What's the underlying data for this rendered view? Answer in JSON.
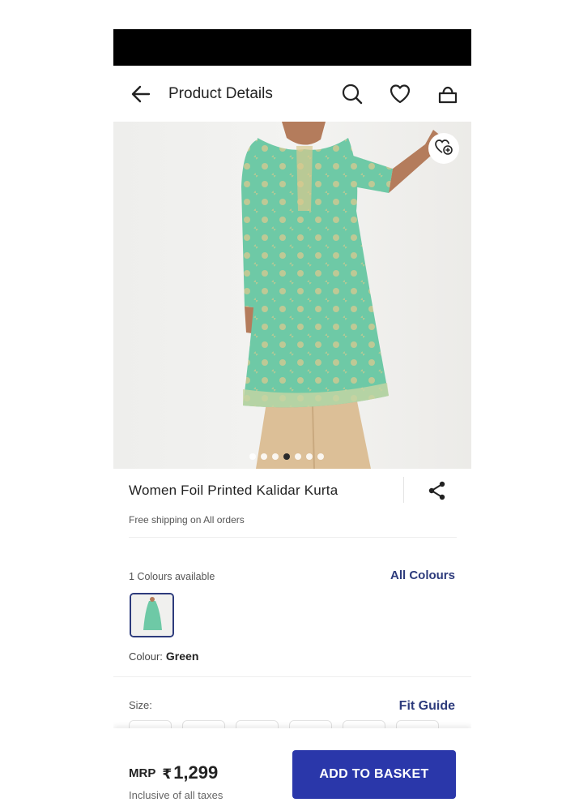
{
  "header": {
    "title": "Product Details",
    "icons": [
      "back-arrow-icon",
      "search-icon",
      "heart-icon",
      "bag-icon"
    ]
  },
  "gallery": {
    "image_count": 7,
    "active_index": 3,
    "wishlist_icon": "heart-plus-icon"
  },
  "product": {
    "name": "Women Foil Printed Kalidar Kurta",
    "shipping_note": "Free shipping on All orders"
  },
  "colours": {
    "count_label": "1 Colours available",
    "all_link": "All Colours",
    "label": "Colour:",
    "selected": "Green"
  },
  "size": {
    "label": "Size:",
    "fit_guide": "Fit Guide"
  },
  "footer": {
    "mrp_label": "MRP",
    "currency": "₹",
    "price": "1,299",
    "tax_note": "Inclusive of all taxes",
    "cta": "ADD TO BASKET"
  },
  "colors": {
    "accent": "#2d3b7c",
    "cta": "#2a37aa",
    "kurta": "#6ec9a6"
  }
}
